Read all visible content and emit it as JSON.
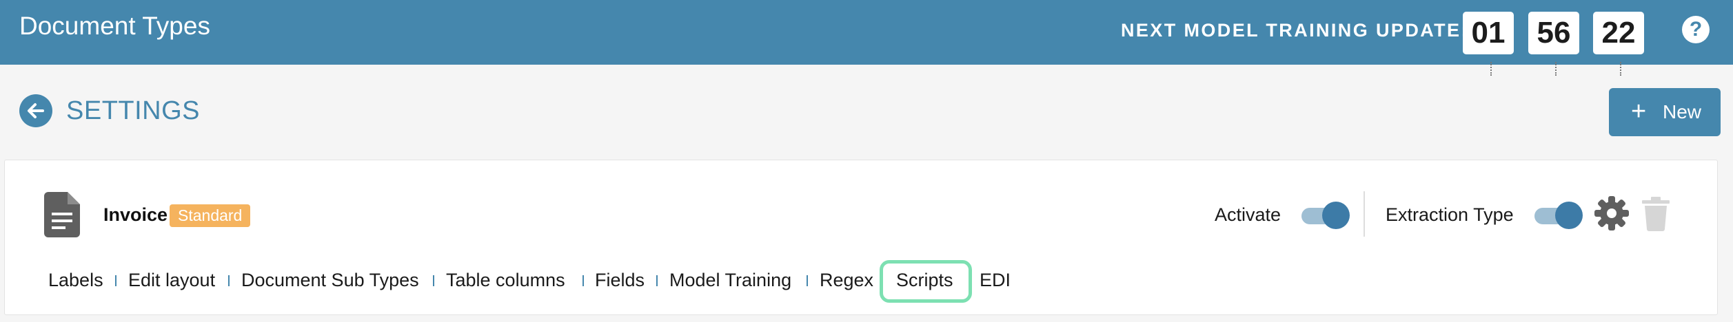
{
  "header": {
    "title": "Document Types",
    "timer_label": "NEXT MODEL TRAINING UPDATE:",
    "timer": {
      "hours": "01",
      "minutes": "56",
      "seconds": "22"
    },
    "help_icon": "question-circle-icon"
  },
  "subheader": {
    "back_icon": "arrow-left-circle-icon",
    "title": "SETTINGS",
    "new_button": {
      "icon": "plus-icon",
      "label": "New"
    }
  },
  "document_type": {
    "icon": "document-icon",
    "name": "Invoice",
    "badge": "Standard",
    "activate": {
      "label": "Activate",
      "on": true
    },
    "extraction_type": {
      "label": "Extraction Type",
      "on": true
    },
    "settings_icon": "gear-icon",
    "delete_icon": "trash-icon",
    "tabs": [
      {
        "label": "Labels"
      },
      {
        "label": "Edit layout"
      },
      {
        "label": "Document Sub Types"
      },
      {
        "label": "Table columns"
      },
      {
        "label": "Fields"
      },
      {
        "label": "Model Training"
      },
      {
        "label": "Regex"
      },
      {
        "label": "Scripts",
        "highlighted": true
      },
      {
        "label": "EDI"
      }
    ]
  },
  "colors": {
    "brand": "#4587ad",
    "badge": "#f5b35e",
    "highlight": "#7de0b2",
    "toggle_knob": "#3d7ba7",
    "toggle_track": "#9ebed3"
  }
}
